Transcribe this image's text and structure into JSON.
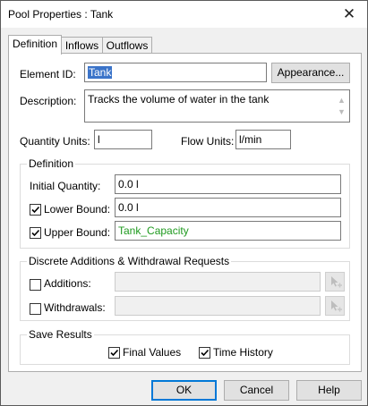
{
  "window": {
    "title": "Pool Properties : Tank",
    "close_glyph": "✕"
  },
  "tabs": [
    {
      "label": "Definition",
      "active": true
    },
    {
      "label": "Inflows",
      "active": false
    },
    {
      "label": "Outflows",
      "active": false
    }
  ],
  "element": {
    "id_label": "Element ID:",
    "id_value": "Tank",
    "appearance_button": "Appearance...",
    "description_label": "Description:",
    "description_value": "Tracks the volume of water in the tank"
  },
  "units": {
    "quantity_label": "Quantity Units:",
    "quantity_value": "l",
    "flow_label": "Flow Units:",
    "flow_value": "l/min"
  },
  "definition": {
    "group_title": "Definition",
    "initial_label": "Initial Quantity:",
    "initial_value": "0.0 l",
    "lower_label": "Lower Bound:",
    "lower_value": "0.0 l",
    "lower_checked": true,
    "upper_label": "Upper Bound:",
    "upper_value": "Tank_Capacity",
    "upper_checked": true
  },
  "discrete": {
    "group_title": "Discrete Additions & Withdrawal Requests",
    "additions_label": "Additions:",
    "additions_checked": false,
    "withdrawals_label": "Withdrawals:",
    "withdrawals_checked": false
  },
  "save": {
    "group_title": "Save Results",
    "final_label": "Final Values",
    "final_checked": true,
    "history_label": "Time History",
    "history_checked": true
  },
  "buttons": {
    "ok": "OK",
    "cancel": "Cancel",
    "help": "Help"
  }
}
